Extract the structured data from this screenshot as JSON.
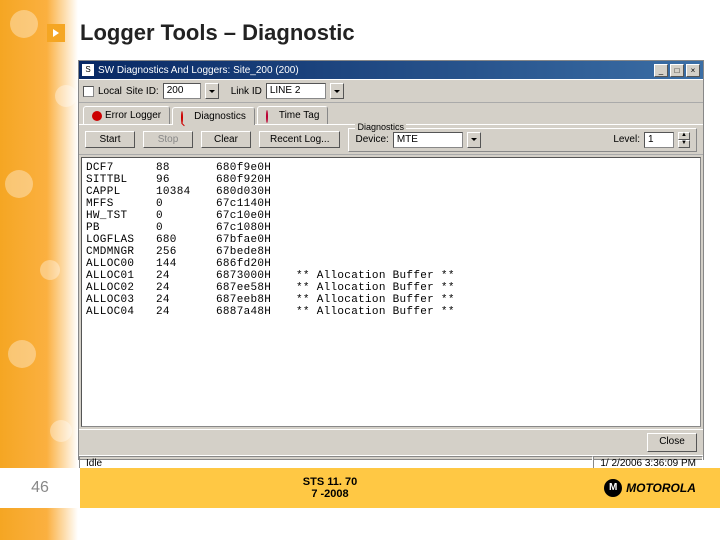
{
  "slide": {
    "title": "Logger Tools – Diagnostic",
    "page_number": "46"
  },
  "window": {
    "title": "SW Diagnostics And Loggers: Site_200 (200)",
    "toolbar1": {
      "local_label": "Local",
      "siteid_label": "Site ID:",
      "siteid_value": "200",
      "linkid_label": "Link ID",
      "linkid_value": "LINE 2"
    },
    "tabs": {
      "t1": "Error Logger",
      "t2": "Diagnostics",
      "t3": "Time Tag"
    },
    "diag_legend": "Diagnostics",
    "buttons": {
      "start": "Start",
      "stop": "Stop",
      "clear": "Clear",
      "recent": "Recent Log...",
      "close": "Close"
    },
    "device_label": "Device:",
    "device_value": "MTE",
    "level_label": "Level:",
    "level_value": "1",
    "rows": [
      {
        "name": "DCF7",
        "val": "88",
        "hex": "680f9e0H",
        "note": ""
      },
      {
        "name": "SITTBL",
        "val": "96",
        "hex": "680f920H",
        "note": ""
      },
      {
        "name": "CAPPL",
        "val": "10384",
        "hex": "680d030H",
        "note": ""
      },
      {
        "name": "MFFS",
        "val": "0",
        "hex": "67c1140H",
        "note": ""
      },
      {
        "name": "HW_TST",
        "val": "0",
        "hex": "67c10e0H",
        "note": ""
      },
      {
        "name": "PB",
        "val": "0",
        "hex": "67c1080H",
        "note": ""
      },
      {
        "name": "LOGFLAS",
        "val": "680",
        "hex": "67bfae0H",
        "note": ""
      },
      {
        "name": "CMDMNGR",
        "val": "256",
        "hex": "67bede8H",
        "note": ""
      },
      {
        "name": "ALLOC00",
        "val": "144",
        "hex": "686fd20H",
        "note": ""
      },
      {
        "name": "ALLOC01",
        "val": "24",
        "hex": "6873000H",
        "note": "** Allocation Buffer **"
      },
      {
        "name": "ALLOC02",
        "val": "24",
        "hex": "687ee58H",
        "note": "** Allocation Buffer **"
      },
      {
        "name": "ALLOC03",
        "val": "24",
        "hex": "687eeb8H",
        "note": "** Allocation Buffer **"
      },
      {
        "name": "ALLOC04",
        "val": "24",
        "hex": "6887a48H",
        "note": "** Allocation Buffer **"
      }
    ],
    "status": {
      "idle": "Idle",
      "time": "1/  2/2006 3:36:09 PM"
    }
  },
  "footer": {
    "sts": "STS 11. 70",
    "date": "7 -2008",
    "brand": "MOTOROLA",
    "logo": "M"
  }
}
